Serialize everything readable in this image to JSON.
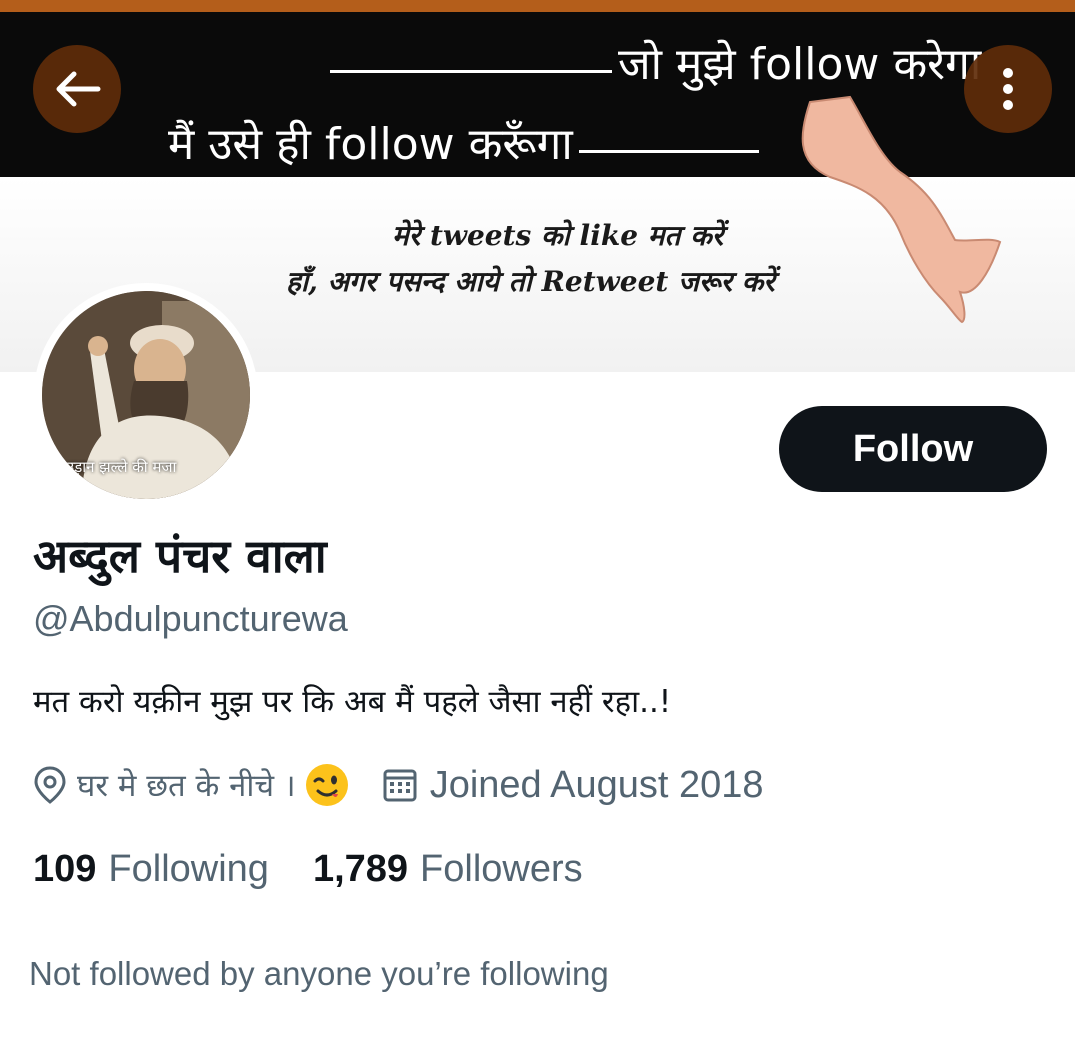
{
  "banner": {
    "line1": "जो मुझे follow करेगा",
    "line2": "मैं उसे ही follow करूँगा",
    "line3": "मेरे tweets को like मत करें",
    "line4": "हाँ, अगर पसन्द आये तो Retweet जरूर करें"
  },
  "nav": {
    "back_icon": "arrow-left-icon",
    "more_icon": "vertical-ellipsis-icon"
  },
  "avatar": {
    "caption": "उड़ान झल्ले की मजा"
  },
  "profile": {
    "follow_label": "Follow",
    "name": "अब्दुल पंचर वाला",
    "handle": "@Abdulpuncturewa",
    "bio": "मत करो यक़ीन मुझ पर कि अब मैं पहले जैसा नहीं रहा..!",
    "location": "घर मे छत के नीचे ।",
    "location_emoji": "winking-face",
    "joined": "Joined August 2018",
    "following_count": "109",
    "following_label": "Following",
    "followers_count": "1,789",
    "followers_label": "Followers",
    "not_followed": "Not followed by anyone you’re following"
  },
  "colors": {
    "top_strip": "#b45e1b",
    "nav_button_bg": "#5f2d0a",
    "follow_bg": "#0f1419",
    "secondary_text": "#536471"
  }
}
